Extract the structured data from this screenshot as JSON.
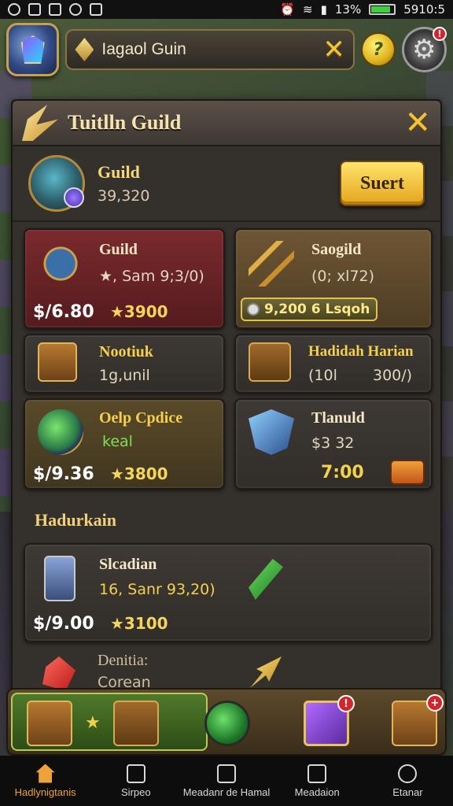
{
  "status_bar": {
    "battery": "13%",
    "time": "5910:5"
  },
  "topbar": {
    "search_value": "Iagaol Guin",
    "help_label": "?",
    "settings_badge": "!"
  },
  "panel": {
    "title": "Tuitlln Guild",
    "summary": {
      "name": "Guild",
      "value": "39,320",
      "button": "Suert"
    },
    "cards": [
      {
        "title": "Guild",
        "sub": "★, Sam 9;3/0)",
        "price": "$/6.80",
        "stars": "★3900"
      },
      {
        "title": "Saogild",
        "sub": "(0; xl72)",
        "badge": "9,200 6 Lsqoh"
      },
      {
        "title": "Nootiuk",
        "sub": "1g,unil"
      },
      {
        "title": "Hadidah Harian",
        "sub": "(10l",
        "sub2": "300/)"
      },
      {
        "title": "Oelp Cpdice",
        "sub": "keal",
        "price": "$/9.36",
        "stars": "★3800"
      },
      {
        "title": "Tlanuld",
        "sub": "$3 32",
        "amount": "7:00"
      }
    ],
    "section_label": "Hadurkain",
    "featured": {
      "title": "Slcadian",
      "sub": "16, Sanr 93,20)",
      "price": "$/9.00",
      "stars": "★3100"
    },
    "footer_item": {
      "title": "Denitia:",
      "sub": "Corean"
    }
  },
  "nav": [
    {
      "label": "Hadlynigtanis",
      "icon": "home-icon",
      "active": true
    },
    {
      "label": "Sirpeo",
      "icon": "edit-icon",
      "active": false
    },
    {
      "label": "Meadanr de Hamal",
      "icon": "map-icon",
      "active": false
    },
    {
      "label": "Meadaion",
      "icon": "shop-icon",
      "active": false
    },
    {
      "label": "Etanar",
      "icon": "search-icon",
      "active": false
    }
  ],
  "colors": {
    "accent_gold": "#f6d77a",
    "button_yellow": "#ffe36a",
    "nav_active": "#f0a23a",
    "badge_red": "#d4242c"
  }
}
